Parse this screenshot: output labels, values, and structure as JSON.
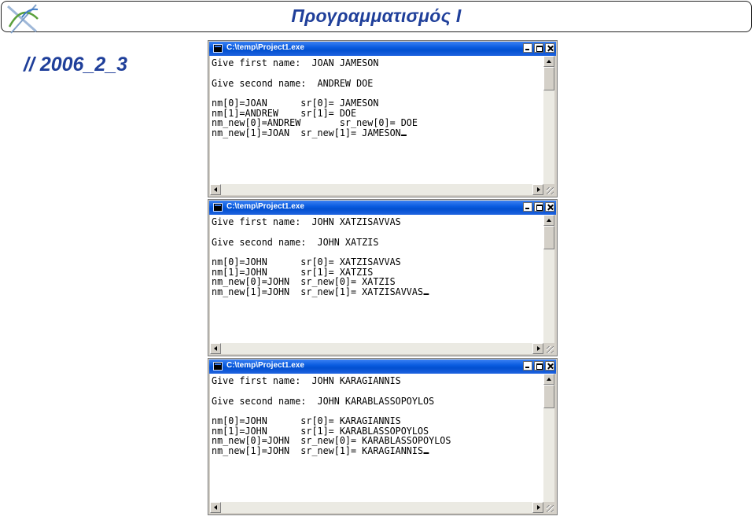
{
  "slide": {
    "title": "Προγραμματισμός Ι",
    "subtitle": "// 2006_2_3"
  },
  "windows": [
    {
      "title": "C:\\temp\\Project1.exe",
      "lines": [
        "Give first name:  JOAN JAMESON",
        "",
        "Give second name:  ANDREW DOE",
        "",
        "nm[0]=JOAN      sr[0]= JAMESON",
        "nm[1]=ANDREW    sr[1]= DOE",
        "nm_new[0]=ANDREW       sr_new[0]= DOE",
        "nm_new[1]=JOAN  sr_new[1]= JAMESON"
      ]
    },
    {
      "title": "C:\\temp\\Project1.exe",
      "lines": [
        "Give first name:  JOHN XATZISAVVAS",
        "",
        "Give second name:  JOHN XATZIS",
        "",
        "nm[0]=JOHN      sr[0]= XATZISAVVAS",
        "nm[1]=JOHN      sr[1]= XATZIS",
        "nm_new[0]=JOHN  sr_new[0]= XATZIS",
        "nm_new[1]=JOHN  sr_new[1]= XATZISAVVAS"
      ]
    },
    {
      "title": "C:\\temp\\Project1.exe",
      "lines": [
        "Give first name:  JOHN KARAGIANNIS",
        "",
        "Give second name:  JOHN KARABLASSOPOYLOS",
        "",
        "nm[0]=JOHN      sr[0]= KARAGIANNIS",
        "nm[1]=JOHN      sr[1]= KARABLASSOPOYLOS",
        "nm_new[0]=JOHN  sr_new[0]= KARABLASSOPOYLOS",
        "nm_new[1]=JOHN  sr_new[1]= KARAGIANNIS"
      ]
    }
  ]
}
